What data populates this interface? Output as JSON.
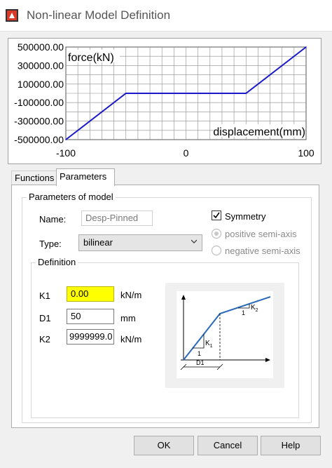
{
  "window": {
    "title": "Non-linear Model Definition",
    "icon": "app-logo-icon"
  },
  "chart_data": {
    "type": "line",
    "title": "",
    "ylabel": "force(kN)",
    "xlabel": "displacement(mm)",
    "x_ticks": [
      "-100",
      "0",
      "100"
    ],
    "y_ticks": [
      "500000.00",
      "300000.00",
      "100000.00",
      "-100000.00",
      "-300000.00",
      "-500000.00"
    ],
    "xlim": [
      -100,
      100
    ],
    "ylim": [
      -500000,
      500000
    ],
    "grid": true,
    "series": [
      {
        "color": "#1a1acc",
        "x": [
          -100,
          -50,
          50,
          100
        ],
        "y": [
          -500000,
          0,
          0,
          500000
        ]
      }
    ]
  },
  "tabs": [
    {
      "label": "Functions",
      "active": false
    },
    {
      "label": "Parameters",
      "active": true
    }
  ],
  "parameters": {
    "group_label": "Parameters of model",
    "name_label": "Name:",
    "name_value": "Desp-Pinned",
    "type_label": "Type:",
    "type_value": "bilinear",
    "symmetry_label": "Symmetry",
    "symmetry_checked": true,
    "positive_label": "positive semi-axis",
    "negative_label": "negative semi-axis"
  },
  "definition": {
    "group_label": "Definition",
    "k1": {
      "label": "K1",
      "value": "0.00",
      "unit": "kN/m"
    },
    "d1": {
      "label": "D1",
      "value": "50",
      "unit": "mm"
    },
    "k2": {
      "label": "K2",
      "value": "9999999.0",
      "unit": "kN/m"
    }
  },
  "diagram": {
    "k1_label": "K",
    "k1_sub": "1",
    "k2_label": "K",
    "k2_sub": "2",
    "d1_label": "D1",
    "one_label": "1"
  },
  "buttons": {
    "ok": "OK",
    "cancel": "Cancel",
    "help": "Help"
  },
  "colors": {
    "accent_line": "#1a1acc",
    "highlight": "#ffff00",
    "diagram_line": "#2a6ab8"
  }
}
